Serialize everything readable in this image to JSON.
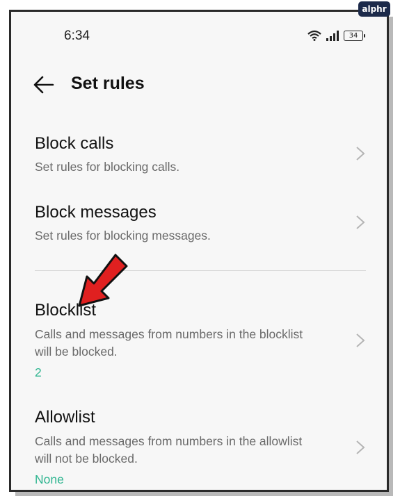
{
  "watermark": "alphr",
  "status_bar": {
    "time": "6:34",
    "battery": "34"
  },
  "header": {
    "back_icon": "arrow-left-icon",
    "title": "Set rules"
  },
  "items": [
    {
      "title": "Block calls",
      "subtitle": "Set rules for blocking calls."
    },
    {
      "title": "Block messages",
      "subtitle": "Set rules for blocking messages."
    },
    {
      "title": "Blocklist",
      "subtitle_line1": "Calls and messages from numbers in the blocklist",
      "subtitle_line2": "will be blocked.",
      "count": "2"
    },
    {
      "title": "Allowlist",
      "subtitle_line1": "Calls and messages from numbers in the allowlist",
      "subtitle_line2": "will not be blocked.",
      "count": "None"
    }
  ],
  "colors": {
    "accent": "#2fb590",
    "annotation_arrow": "#e02020",
    "background": "#f7f7f7"
  }
}
